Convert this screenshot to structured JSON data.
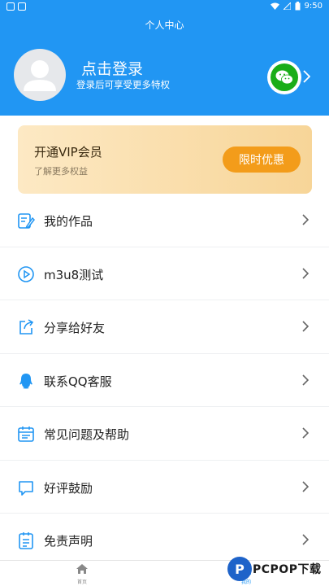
{
  "status_bar": {
    "time": "9:50"
  },
  "header": {
    "title": "个人中心",
    "login_title": "点击登录",
    "login_subtitle": "登录后可享受更多特权"
  },
  "vip": {
    "title": "开通VIP会员",
    "subtitle": "了解更多权益",
    "button": "限时优惠"
  },
  "menu": [
    {
      "label": "我的作品",
      "icon": "edit-icon"
    },
    {
      "label": "m3u8测试",
      "icon": "play-icon"
    },
    {
      "label": "分享给好友",
      "icon": "share-icon"
    },
    {
      "label": "联系QQ客服",
      "icon": "qq-icon"
    },
    {
      "label": "常见问题及帮助",
      "icon": "calendar-icon"
    },
    {
      "label": "好评鼓励",
      "icon": "comment-icon"
    },
    {
      "label": "免责声明",
      "icon": "document-icon"
    }
  ],
  "bottom_nav": {
    "home": "首页",
    "mine": "我的"
  },
  "watermark": {
    "text": "PCPOP下载",
    "letter": "P"
  },
  "colors": {
    "primary": "#2196f3",
    "vip_button": "#f39c1a",
    "wechat": "#1aad19"
  }
}
